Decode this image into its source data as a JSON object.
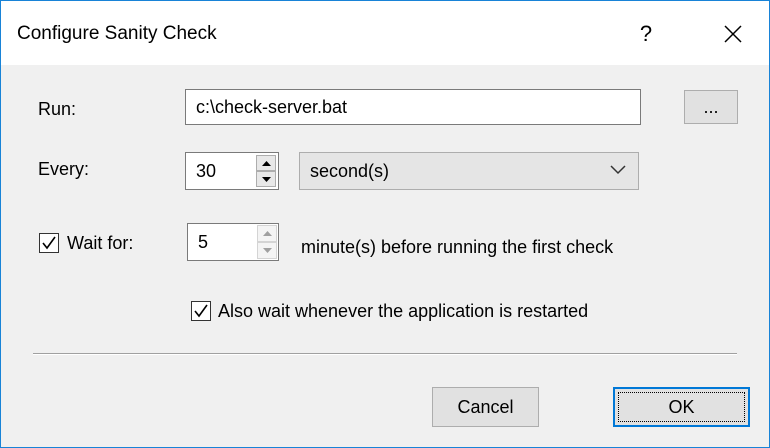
{
  "dialog": {
    "title": "Configure Sanity Check",
    "help_label": "?",
    "close_icon": "close-icon"
  },
  "run": {
    "label": "Run:",
    "value": "c:\\check-server.bat",
    "browse_label": "..."
  },
  "every": {
    "label": "Every:",
    "value": "30",
    "unit_selected": "second(s)"
  },
  "wait_for": {
    "checked": true,
    "label": "Wait for:",
    "value": "5",
    "suffix": "minute(s) before running the first check"
  },
  "also_wait": {
    "checked": true,
    "label": "Also wait whenever the application is restarted"
  },
  "buttons": {
    "cancel": "Cancel",
    "ok": "OK"
  }
}
